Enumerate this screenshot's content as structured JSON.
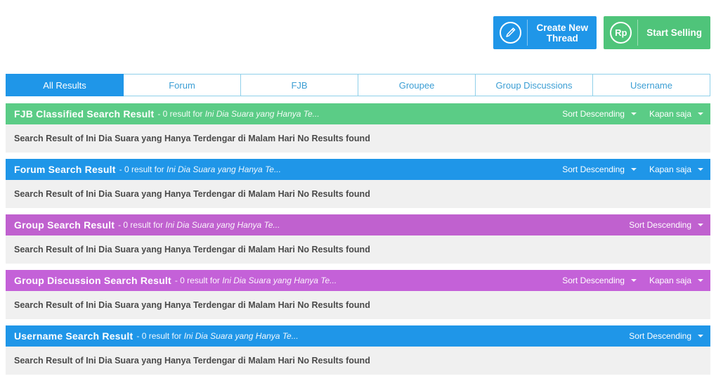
{
  "topbar": {
    "buttons": [
      {
        "id": "create-new-thread",
        "icon": "pencil-icon",
        "icon_text": "",
        "label": "Create New\nThread",
        "color": "#1f96e8"
      },
      {
        "id": "start-selling",
        "icon": "rupiah-icon",
        "icon_text": "Rp",
        "label": "Start Selling",
        "color": "#4fc47a"
      }
    ]
  },
  "tabs": [
    {
      "label": "All Results",
      "active": true
    },
    {
      "label": "Forum",
      "active": false
    },
    {
      "label": "FJB",
      "active": false
    },
    {
      "label": "Groupee",
      "active": false
    },
    {
      "label": "Group Discussions",
      "active": false
    },
    {
      "label": "Username",
      "active": false
    }
  ],
  "panels": [
    {
      "id": "fjb-classified-search-result",
      "title": "FJB Classified Search Result",
      "result_prefix": "- 0 result for ",
      "query": "Ini Dia Suara yang Hanya Te...",
      "color": "#5bcc86",
      "sort_label": "Sort Descending",
      "time_label": "Kapan saja",
      "has_time_filter": true,
      "body": "Search Result of Ini Dia Suara yang Hanya Terdengar di Malam Hari No Results found"
    },
    {
      "id": "forum-search-result",
      "title": "Forum Search Result",
      "result_prefix": "- 0 result for ",
      "query": "Ini Dia Suara yang Hanya Te...",
      "color": "#1f96e8",
      "sort_label": "Sort Descending",
      "time_label": "Kapan saja",
      "has_time_filter": true,
      "body": "Search Result of Ini Dia Suara yang Hanya Terdengar di Malam Hari No Results found"
    },
    {
      "id": "group-search-result",
      "title": "Group Search Result",
      "result_prefix": "- 0 result for ",
      "query": "Ini Dia Suara yang Hanya Te...",
      "color": "#c061cf",
      "sort_label": "Sort Descending",
      "time_label": "",
      "has_time_filter": false,
      "body": "Search Result of Ini Dia Suara yang Hanya Terdengar di Malam Hari No Results found"
    },
    {
      "id": "group-discussion-search-result",
      "title": "Group Discussion Search Result",
      "result_prefix": "- 0 result for ",
      "query": "Ini Dia Suara yang Hanya Te...",
      "color": "#c461d8",
      "sort_label": "Sort Descending",
      "time_label": "Kapan saja",
      "has_time_filter": true,
      "body": "Search Result of Ini Dia Suara yang Hanya Terdengar di Malam Hari No Results found"
    },
    {
      "id": "username-search-result",
      "title": "Username Search Result",
      "result_prefix": "- 0 result for ",
      "query": "Ini Dia Suara yang Hanya Te...",
      "color": "#1f96e8",
      "sort_label": "Sort Descending",
      "time_label": "",
      "has_time_filter": false,
      "body": "Search Result of Ini Dia Suara yang Hanya Terdengar di Malam Hari No Results found"
    }
  ]
}
